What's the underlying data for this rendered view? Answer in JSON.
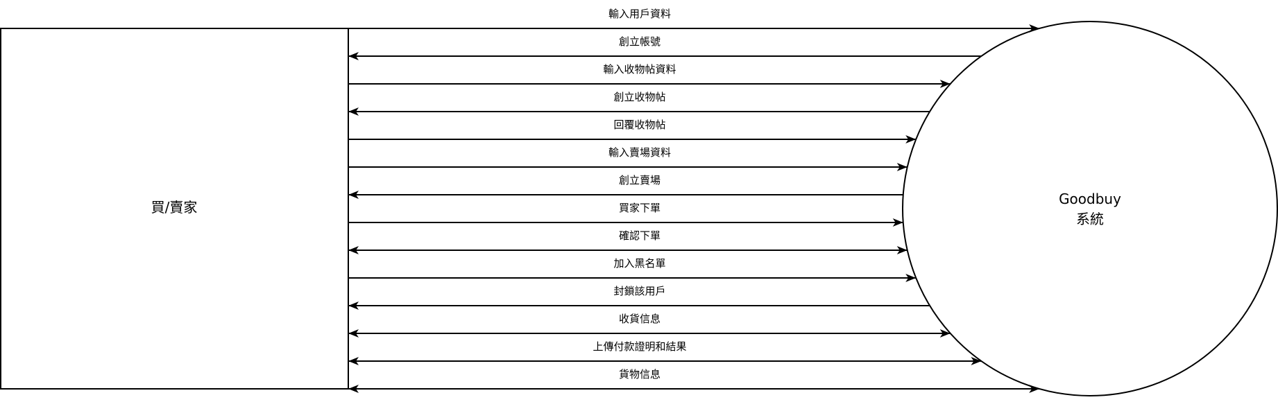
{
  "entity": {
    "label": "買/賣家"
  },
  "system": {
    "name": "Goodbuy",
    "subtitle": "系統"
  },
  "flows": [
    {
      "label": "輸入用戶資料",
      "direction": "to-system"
    },
    {
      "label": "創立帳號",
      "direction": "to-entity"
    },
    {
      "label": "輸入收物帖資料",
      "direction": "to-system"
    },
    {
      "label": "創立收物帖",
      "direction": "to-entity"
    },
    {
      "label": "回覆收物帖",
      "direction": "to-system"
    },
    {
      "label": "輸入賣場資料",
      "direction": "to-system"
    },
    {
      "label": "創立賣場",
      "direction": "to-entity"
    },
    {
      "label": "買家下單",
      "direction": "to-system"
    },
    {
      "label": "確認下單",
      "direction": "both"
    },
    {
      "label": "加入黑名單",
      "direction": "to-system"
    },
    {
      "label": "封鎖該用戶",
      "direction": "to-entity"
    },
    {
      "label": "收貨信息",
      "direction": "both"
    },
    {
      "label": "上傳付款證明和結果",
      "direction": "both"
    },
    {
      "label": "貨物信息",
      "direction": "both"
    }
  ]
}
